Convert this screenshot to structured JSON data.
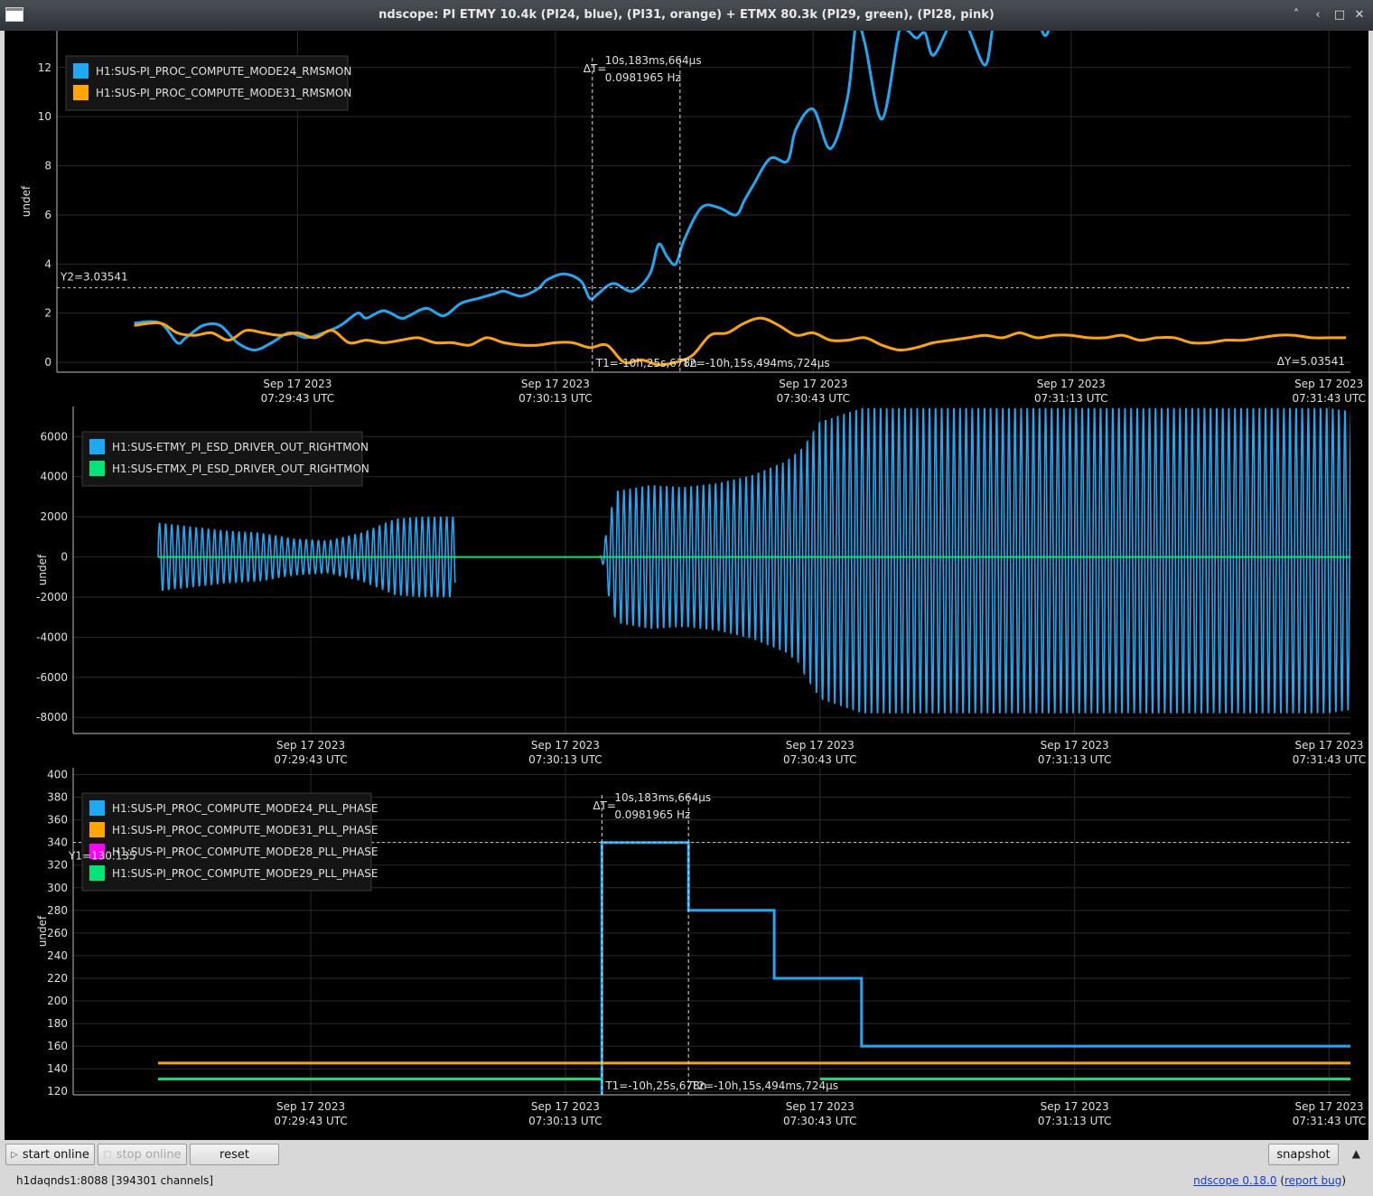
{
  "window": {
    "title": "ndscope: PI ETMY 10.4k (PI24, blue), (PI31, orange) + ETMX 80.3k (PI29, green), (PI28, pink)",
    "buttons": {
      "minimize": "˄",
      "maximize": "□",
      "close": "✕",
      "restore": "‹"
    }
  },
  "colors": {
    "blue": "#1fa9f5",
    "orange": "#ffa500",
    "magenta": "#ff00ff",
    "green": "#00e676",
    "grid": "#2a2a2a",
    "axis_text": "#e0e0e0"
  },
  "time_ticks": [
    {
      "date": "Sep 17 2023",
      "time": "07:29:43 UTC",
      "t": 0
    },
    {
      "date": "Sep 17 2023",
      "time": "07:30:13 UTC",
      "t": 30
    },
    {
      "date": "Sep 17 2023",
      "time": "07:30:43 UTC",
      "t": 60
    },
    {
      "date": "Sep 17 2023",
      "time": "07:31:13 UTC",
      "t": 90
    },
    {
      "date": "Sep 17 2023",
      "time": "07:31:43 UTC",
      "t": 120
    }
  ],
  "cursors": {
    "delta_t": "ΔT=",
    "delta_t_value": "10s,183ms,664µs",
    "delta_freq": "0.0981965 Hz",
    "t1": "T1=-10h,25s,678n",
    "t2": "T2=-10h,15s,494ms,724µs",
    "t1_time": 34.3,
    "t2_time": 44.5
  },
  "chart_data": [
    {
      "type": "line",
      "ylabel": "undef",
      "ylim": [
        -0.4,
        13.5
      ],
      "yticks": [
        "0",
        "2",
        "4",
        "6",
        "8",
        "10",
        "12"
      ],
      "y2_label": "Y2=3.03541",
      "delta_y": "ΔY=5.03541",
      "y2": 3.03541,
      "legend": [
        {
          "name": "H1:SUS-PI_PROC_COMPUTE_MODE24_RMSMON",
          "color": "blue"
        },
        {
          "name": "H1:SUS-PI_PROC_COMPUTE_MODE31_RMSMON",
          "color": "orange"
        }
      ],
      "series": [
        {
          "name": "H1:SUS-PI_PROC_COMPUTE_MODE24_RMSMON",
          "color": "blue",
          "x": [
            -19,
            -16,
            -14,
            -13,
            -11,
            -9,
            -7,
            -5,
            -3,
            -1,
            1,
            3,
            5,
            7,
            8,
            10,
            12,
            13,
            15,
            17,
            19,
            21,
            23,
            24,
            26,
            28,
            29,
            31,
            33,
            34,
            35,
            36,
            37,
            39,
            41,
            42,
            43,
            44,
            45,
            47,
            49,
            51,
            52,
            53,
            55,
            57,
            58,
            60,
            62,
            64,
            65,
            66,
            68,
            70,
            71,
            72,
            73,
            74,
            76,
            77,
            78,
            80,
            81,
            82,
            83,
            84,
            86,
            87,
            88,
            90,
            92,
            94,
            95,
            96
          ],
          "y": [
            1.6,
            1.6,
            0.8,
            1.0,
            1.5,
            1.5,
            0.8,
            0.5,
            0.8,
            1.2,
            1.0,
            1.2,
            1.5,
            2.0,
            1.8,
            2.1,
            1.8,
            1.9,
            2.2,
            1.9,
            2.4,
            2.6,
            2.8,
            2.9,
            2.7,
            3.0,
            3.35,
            3.6,
            3.3,
            2.6,
            2.8,
            3.1,
            3.2,
            2.9,
            3.6,
            4.8,
            4.3,
            4.0,
            5.0,
            6.3,
            6.3,
            6.0,
            6.6,
            7.2,
            8.3,
            8.2,
            9.5,
            10.3,
            8.7,
            10.8,
            13.8,
            13.0,
            9.9,
            13.5,
            13.5,
            13.2,
            13.4,
            12.5,
            13.8,
            13.6,
            13.6,
            12.1,
            13.8,
            13.9,
            13.9,
            13.9,
            13.9,
            13.3,
            13.9,
            13.9,
            13.9,
            13.9,
            13.9,
            13.9
          ]
        },
        {
          "name": "H1:SUS-PI_PROC_COMPUTE_MODE31_RMSMON",
          "color": "orange",
          "x": [
            -19,
            -16,
            -14,
            -12,
            -10,
            -8,
            -6,
            -4,
            -2,
            0,
            2,
            4,
            6,
            8,
            10,
            12,
            14,
            16,
            18,
            20,
            22,
            24,
            26,
            28,
            30,
            32,
            34,
            36,
            38,
            40,
            42,
            44,
            46,
            48,
            50,
            52,
            54,
            56,
            58,
            60,
            62,
            64,
            66,
            68,
            70,
            72,
            74,
            76,
            78,
            80,
            82,
            84,
            86,
            88,
            90,
            92,
            94,
            96,
            98,
            100,
            102,
            104,
            106,
            108,
            110,
            112,
            114,
            116,
            118,
            120,
            122
          ],
          "y": [
            1.5,
            1.6,
            1.2,
            1.1,
            1.2,
            0.9,
            1.3,
            1.2,
            1.1,
            1.2,
            1.0,
            1.3,
            0.8,
            0.9,
            0.8,
            0.9,
            1.0,
            0.8,
            0.8,
            0.7,
            1.0,
            0.8,
            0.7,
            0.7,
            0.8,
            0.8,
            0.6,
            0.7,
            0.0,
            0.1,
            -0.1,
            0.0,
            0.3,
            1.1,
            1.2,
            1.6,
            1.8,
            1.5,
            1.1,
            1.2,
            0.9,
            0.9,
            1.0,
            0.7,
            0.5,
            0.6,
            0.8,
            0.9,
            1.0,
            1.1,
            1.0,
            1.2,
            1.0,
            1.1,
            1.1,
            1.0,
            1.0,
            1.1,
            0.9,
            1.0,
            1.0,
            0.8,
            0.8,
            0.9,
            0.9,
            1.0,
            1.1,
            1.1,
            1.0,
            1.0,
            1.0
          ]
        }
      ]
    },
    {
      "type": "line",
      "ylabel": "undef",
      "ylim": [
        -8800,
        7500
      ],
      "yticks": [
        "-8000",
        "-6000",
        "-4000",
        "-2000",
        "0",
        "2000",
        "4000",
        "6000"
      ],
      "legend": [
        {
          "name": "H1:SUS-ETMY_PI_ESD_DRIVER_OUT_RIGHTMON",
          "color": "blue"
        },
        {
          "name": "H1:SUS-ETMX_PI_ESD_DRIVER_OUT_RIGHTMON",
          "color": "green"
        }
      ],
      "series": [
        {
          "name": "H1:SUS-ETMY_PI_ESD_DRIVER_OUT_RIGHTMON",
          "color": "blue",
          "x_range": [
            -18,
            123
          ],
          "gap": [
            17,
            34
          ],
          "cycle_period": 0.72,
          "envelope_x": [
            -18,
            -14,
            -10,
            -6,
            -2,
            2,
            6,
            10,
            13,
            17,
            34,
            36,
            40,
            44,
            48,
            52,
            56,
            58,
            60,
            65,
            70,
            80,
            90,
            100,
            110,
            120,
            123
          ],
          "envelope_y": [
            1700,
            1500,
            1300,
            1200,
            900,
            800,
            1200,
            1900,
            2000,
            2000,
            300,
            3300,
            3600,
            3500,
            3700,
            4100,
            4800,
            5500,
            6800,
            7500,
            7500,
            7500,
            7500,
            7500,
            7500,
            7500,
            7300
          ]
        },
        {
          "name": "H1:SUS-ETMX_PI_ESD_DRIVER_OUT_RIGHTMON",
          "color": "green",
          "x": [
            -18,
            123
          ],
          "y": [
            0,
            0
          ]
        }
      ]
    },
    {
      "type": "line",
      "ylabel": "undef",
      "ylim": [
        117,
        406
      ],
      "yticks": [
        "120",
        "140",
        "160",
        "180",
        "200",
        "220",
        "240",
        "260",
        "280",
        "300",
        "320",
        "340",
        "360",
        "380",
        "400"
      ],
      "y1_label": "Y1=130.135",
      "y1": 340.0,
      "legend": [
        {
          "name": "H1:SUS-PI_PROC_COMPUTE_MODE24_PLL_PHASE",
          "color": "blue"
        },
        {
          "name": "H1:SUS-PI_PROC_COMPUTE_MODE31_PLL_PHASE",
          "color": "orange"
        },
        {
          "name": "H1:SUS-PI_PROC_COMPUTE_MODE28_PLL_PHASE",
          "color": "magenta"
        },
        {
          "name": "H1:SUS-PI_PROC_COMPUTE_MODE29_PLL_PHASE",
          "color": "green"
        }
      ],
      "series": [
        {
          "name": "H1:SUS-PI_PROC_COMPUTE_MODE24_PLL_PHASE",
          "color": "blue",
          "x": [
            34.3,
            34.3,
            44.5,
            44.5,
            54.6,
            54.6,
            64.9,
            64.9,
            123
          ],
          "y": [
            117,
            340,
            340,
            280,
            280,
            220,
            220,
            160,
            160
          ]
        },
        {
          "name": "H1:SUS-PI_PROC_COMPUTE_MODE31_PLL_PHASE",
          "color": "orange",
          "x": [
            -18,
            123
          ],
          "y": [
            145,
            145
          ]
        },
        {
          "name": "H1:SUS-PI_PROC_COMPUTE_MODE29_PLL_PHASE",
          "color": "green",
          "x": [
            -18,
            34.3
          ],
          "y": [
            131,
            131
          ]
        },
        {
          "name": "H1:SUS-PI_PROC_COMPUTE_MODE29_PLL_PHASE",
          "color": "green",
          "x": [
            60,
            123
          ],
          "y": [
            131,
            131
          ]
        }
      ]
    }
  ],
  "bottom": {
    "start_online": "start online",
    "stop_online": "stop online",
    "reset": "reset",
    "snapshot": "snapshot",
    "status": "h1daqnds1:8088  [394301 channels]",
    "version_link": "ndscope 0.18.0",
    "version_paren_open": " (",
    "report_link": "report bug",
    "version_paren_close": ")"
  }
}
